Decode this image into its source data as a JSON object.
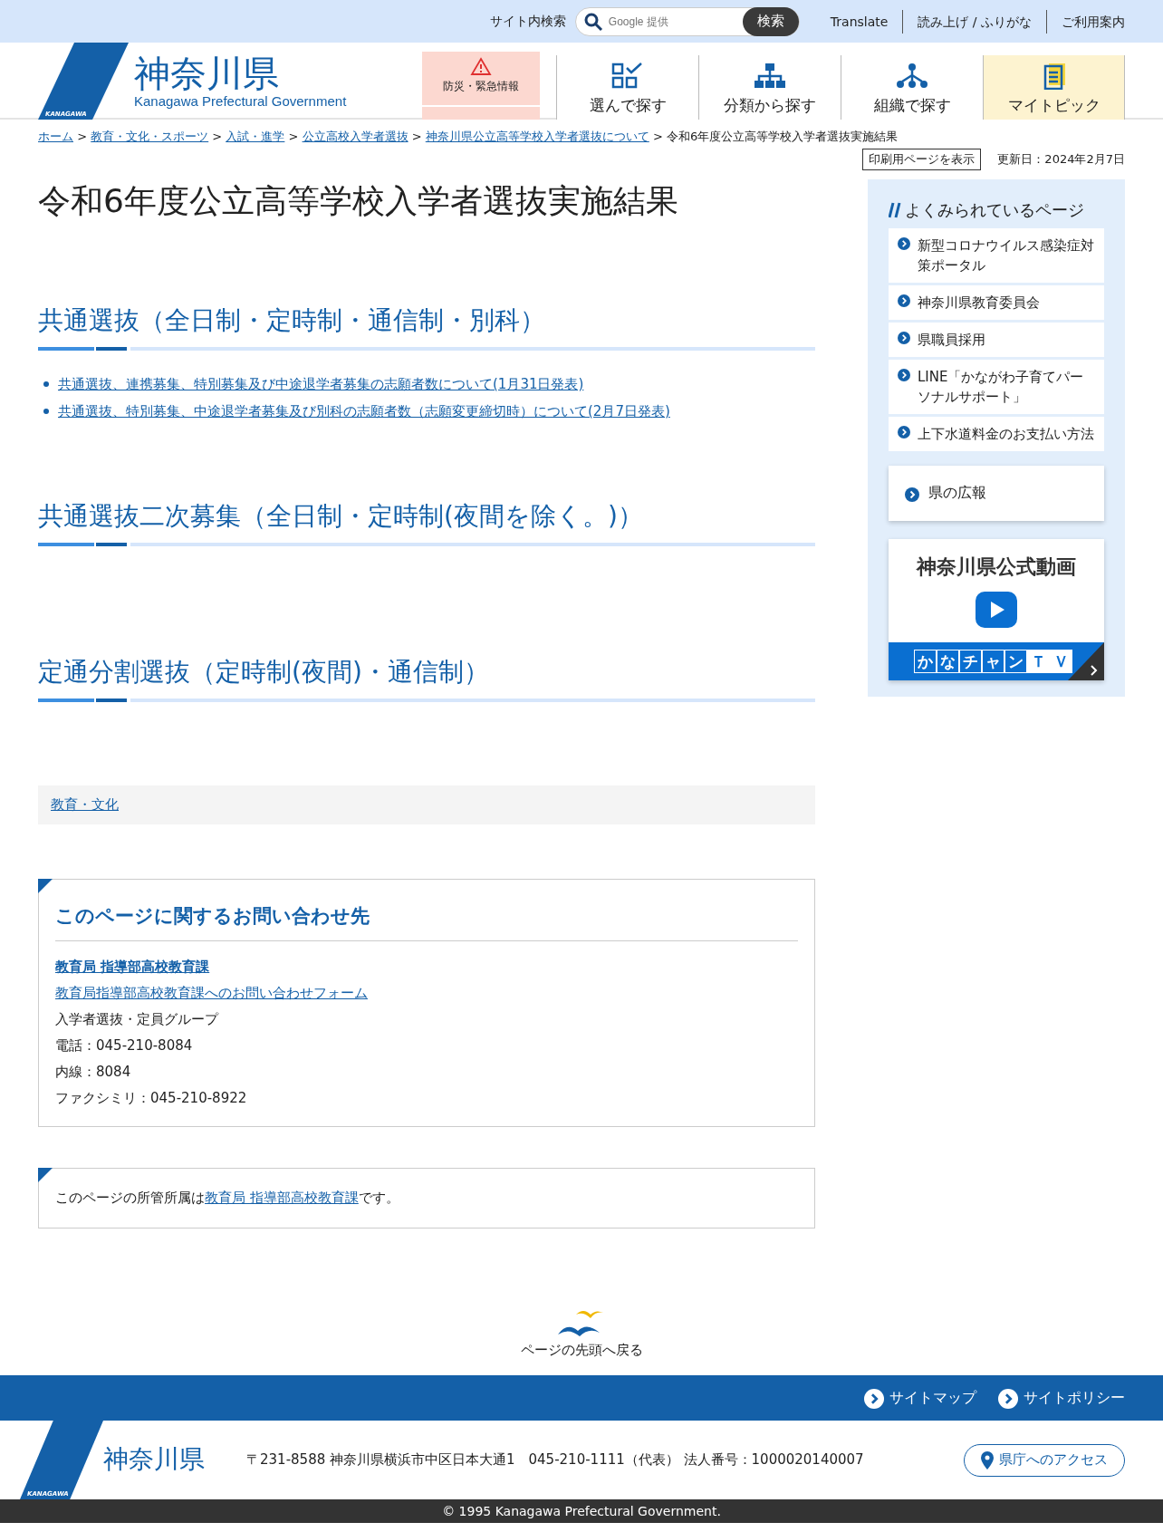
{
  "utility_bar": {
    "search_label": "サイト内検索",
    "search": {
      "placeholder": "Google 提供"
    },
    "search_button": "検索",
    "links": [
      "Translate",
      "読み上げ / ふりがな",
      "ご利用案内"
    ]
  },
  "header": {
    "logo_small": "KANAGAWA",
    "logo_title": "神奈川県",
    "logo_subtitle": "Kanagawa Prefectural Government",
    "emergency": "防災・緊急情報",
    "nav": [
      {
        "kind": "grid",
        "label": "選んで探す",
        "selected": false
      },
      {
        "kind": "tree",
        "label": "分類から探す",
        "selected": false
      },
      {
        "kind": "org",
        "label": "組織で探す",
        "selected": false
      },
      {
        "kind": "note",
        "label": "マイトピック",
        "selected": true
      }
    ]
  },
  "breadcrumb": {
    "separator": ">",
    "links": [
      "ホーム",
      "教育・文化・スポーツ",
      "入試・進学",
      "公立高校入学者選抜",
      "神奈川県公立高等学校入学者選抜について"
    ],
    "current": "令和6年度公立高等学校入学者選抜実施結果"
  },
  "print_button": "印刷用ページを表示",
  "updated": "更新日：2024年2月7日",
  "title": "令和6年度公立高等学校入学者選抜実施結果",
  "sections": [
    {
      "heading": "共通選抜（全日制・定時制・通信制・別科）",
      "links": [
        "共通選抜、連携募集、特別募集及び中途退学者募集の志願者数について(1月31日発表)",
        "共通選抜、特別募集、中途退学者募集及び別科の志願者数（志願変更締切時）について(2月7日発表)"
      ]
    },
    {
      "heading": "共通選抜二次募集（全日制・定時制(夜間を除く。)）"
    },
    {
      "heading": "定通分割選抜（定時制(夜間)・通信制）"
    }
  ],
  "category_link": "教育・文化",
  "contact": {
    "heading": "このページに関するお問い合わせ先",
    "department": "教育局 指導部高校教育課",
    "form_link": "教育局指導部高校教育課へのお問い合わせフォーム",
    "lines": [
      "入学者選抜・定員グループ",
      "電話：045-210-8084",
      "内線：8084",
      "ファクシミリ：045-210-8922"
    ]
  },
  "owner": {
    "before": "このページの所管所属は",
    "link": "教育局 指導部高校教育課",
    "after": "です。"
  },
  "sidebar": {
    "heading": "よくみられているページ",
    "links": [
      "新型コロナウイルス感染症対策ポータル",
      "神奈川県教育委員会",
      "県職員採用",
      "LINE「かながわ子育てパーソナルサポート」",
      "上下水道料金のお支払い方法"
    ],
    "koho": "県の広報",
    "video_title": "神奈川県公式動画",
    "video_banner": [
      "か",
      "な",
      "チ",
      "ャ",
      "ン",
      "Ｔ",
      "Ｖ"
    ]
  },
  "back_to_top": "ページの先頭へ戻る",
  "footer": {
    "links": [
      "サイトマップ",
      "サイトポリシー"
    ],
    "logo_small": "KANAGAWA",
    "logo_title": "神奈川県",
    "address": "〒231-8588 神奈川県横浜市中区日本大通1　045-210-1111（代表）  法人番号：1000020140007",
    "access": "県庁へのアクセス",
    "copyright": "© 1995 Kanagawa Prefectural Government."
  }
}
